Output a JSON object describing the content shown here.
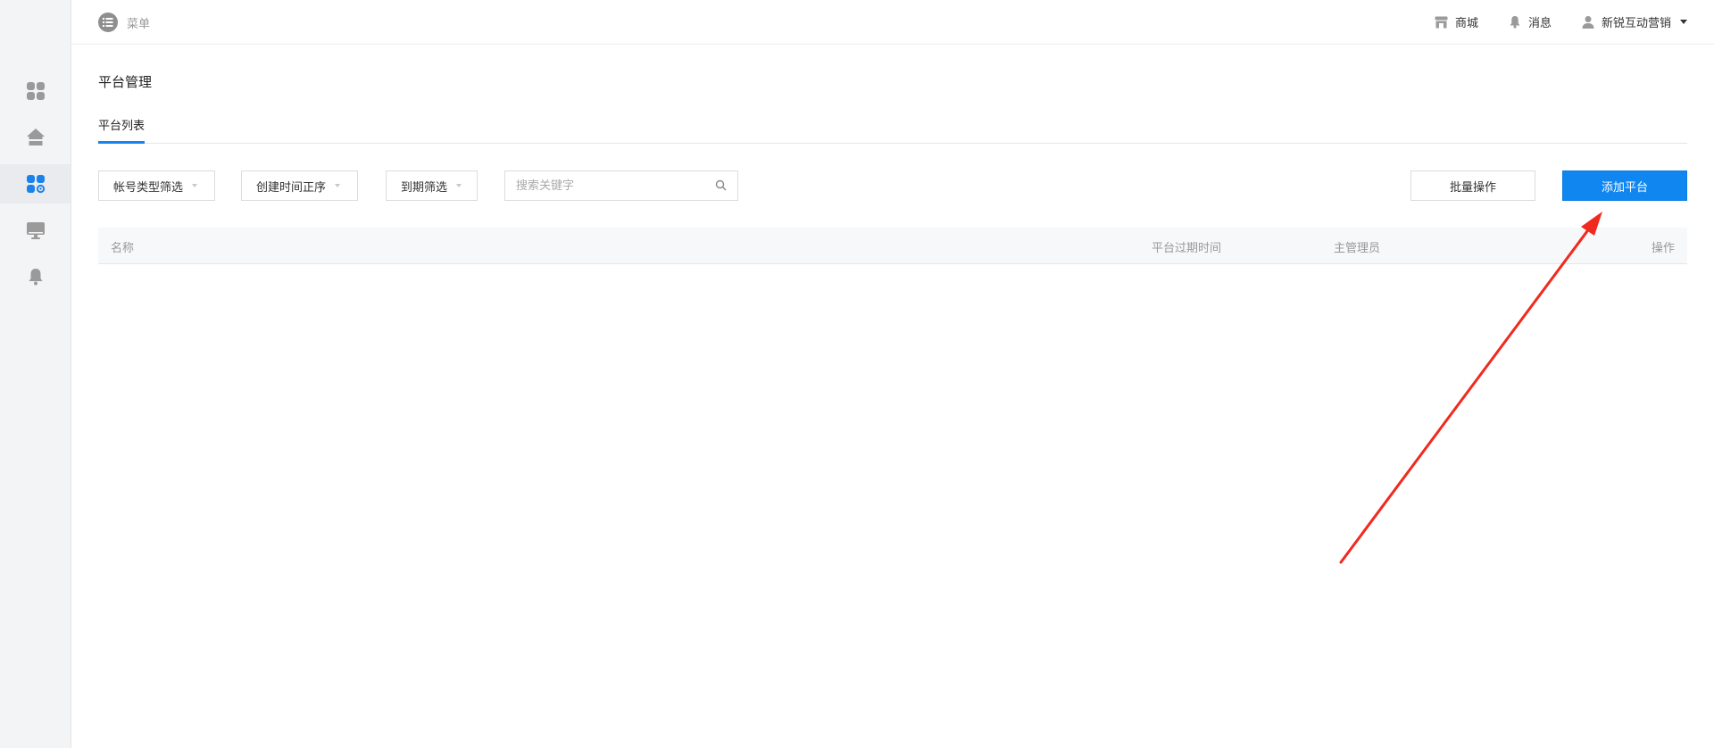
{
  "topbar": {
    "menu_label": "菜单",
    "links": [
      {
        "label": "商城",
        "icon": "store-icon"
      },
      {
        "label": "消息",
        "icon": "bell-icon"
      },
      {
        "label": "新锐互动营销",
        "icon": "user-icon"
      }
    ]
  },
  "sidebar": {
    "items": [
      {
        "icon": "dashboard-grid-icon",
        "active": false
      },
      {
        "icon": "home-icon",
        "active": false
      },
      {
        "icon": "apps-settings-icon",
        "active": true
      },
      {
        "icon": "monitor-icon",
        "active": false
      },
      {
        "icon": "bell-icon",
        "active": false
      }
    ]
  },
  "page": {
    "title": "平台管理",
    "tabs": [
      {
        "label": "平台列表",
        "active": true
      }
    ]
  },
  "filters": {
    "account_type": "帐号类型筛选",
    "created_sort": "创建时间正序",
    "expiry_filter": "到期筛选",
    "search_placeholder": "搜索关键字"
  },
  "actions": {
    "batch_label": "批量操作",
    "add_label": "添加平台"
  },
  "table": {
    "columns": [
      "名称",
      "平台过期时间",
      "主管理员",
      "操作"
    ],
    "rows": []
  },
  "colors": {
    "primary": "#0f86f0",
    "sidebar_bg": "#f3f4f6",
    "active_icon": "#1a82ea",
    "annotation_arrow": "#f02a1e"
  }
}
